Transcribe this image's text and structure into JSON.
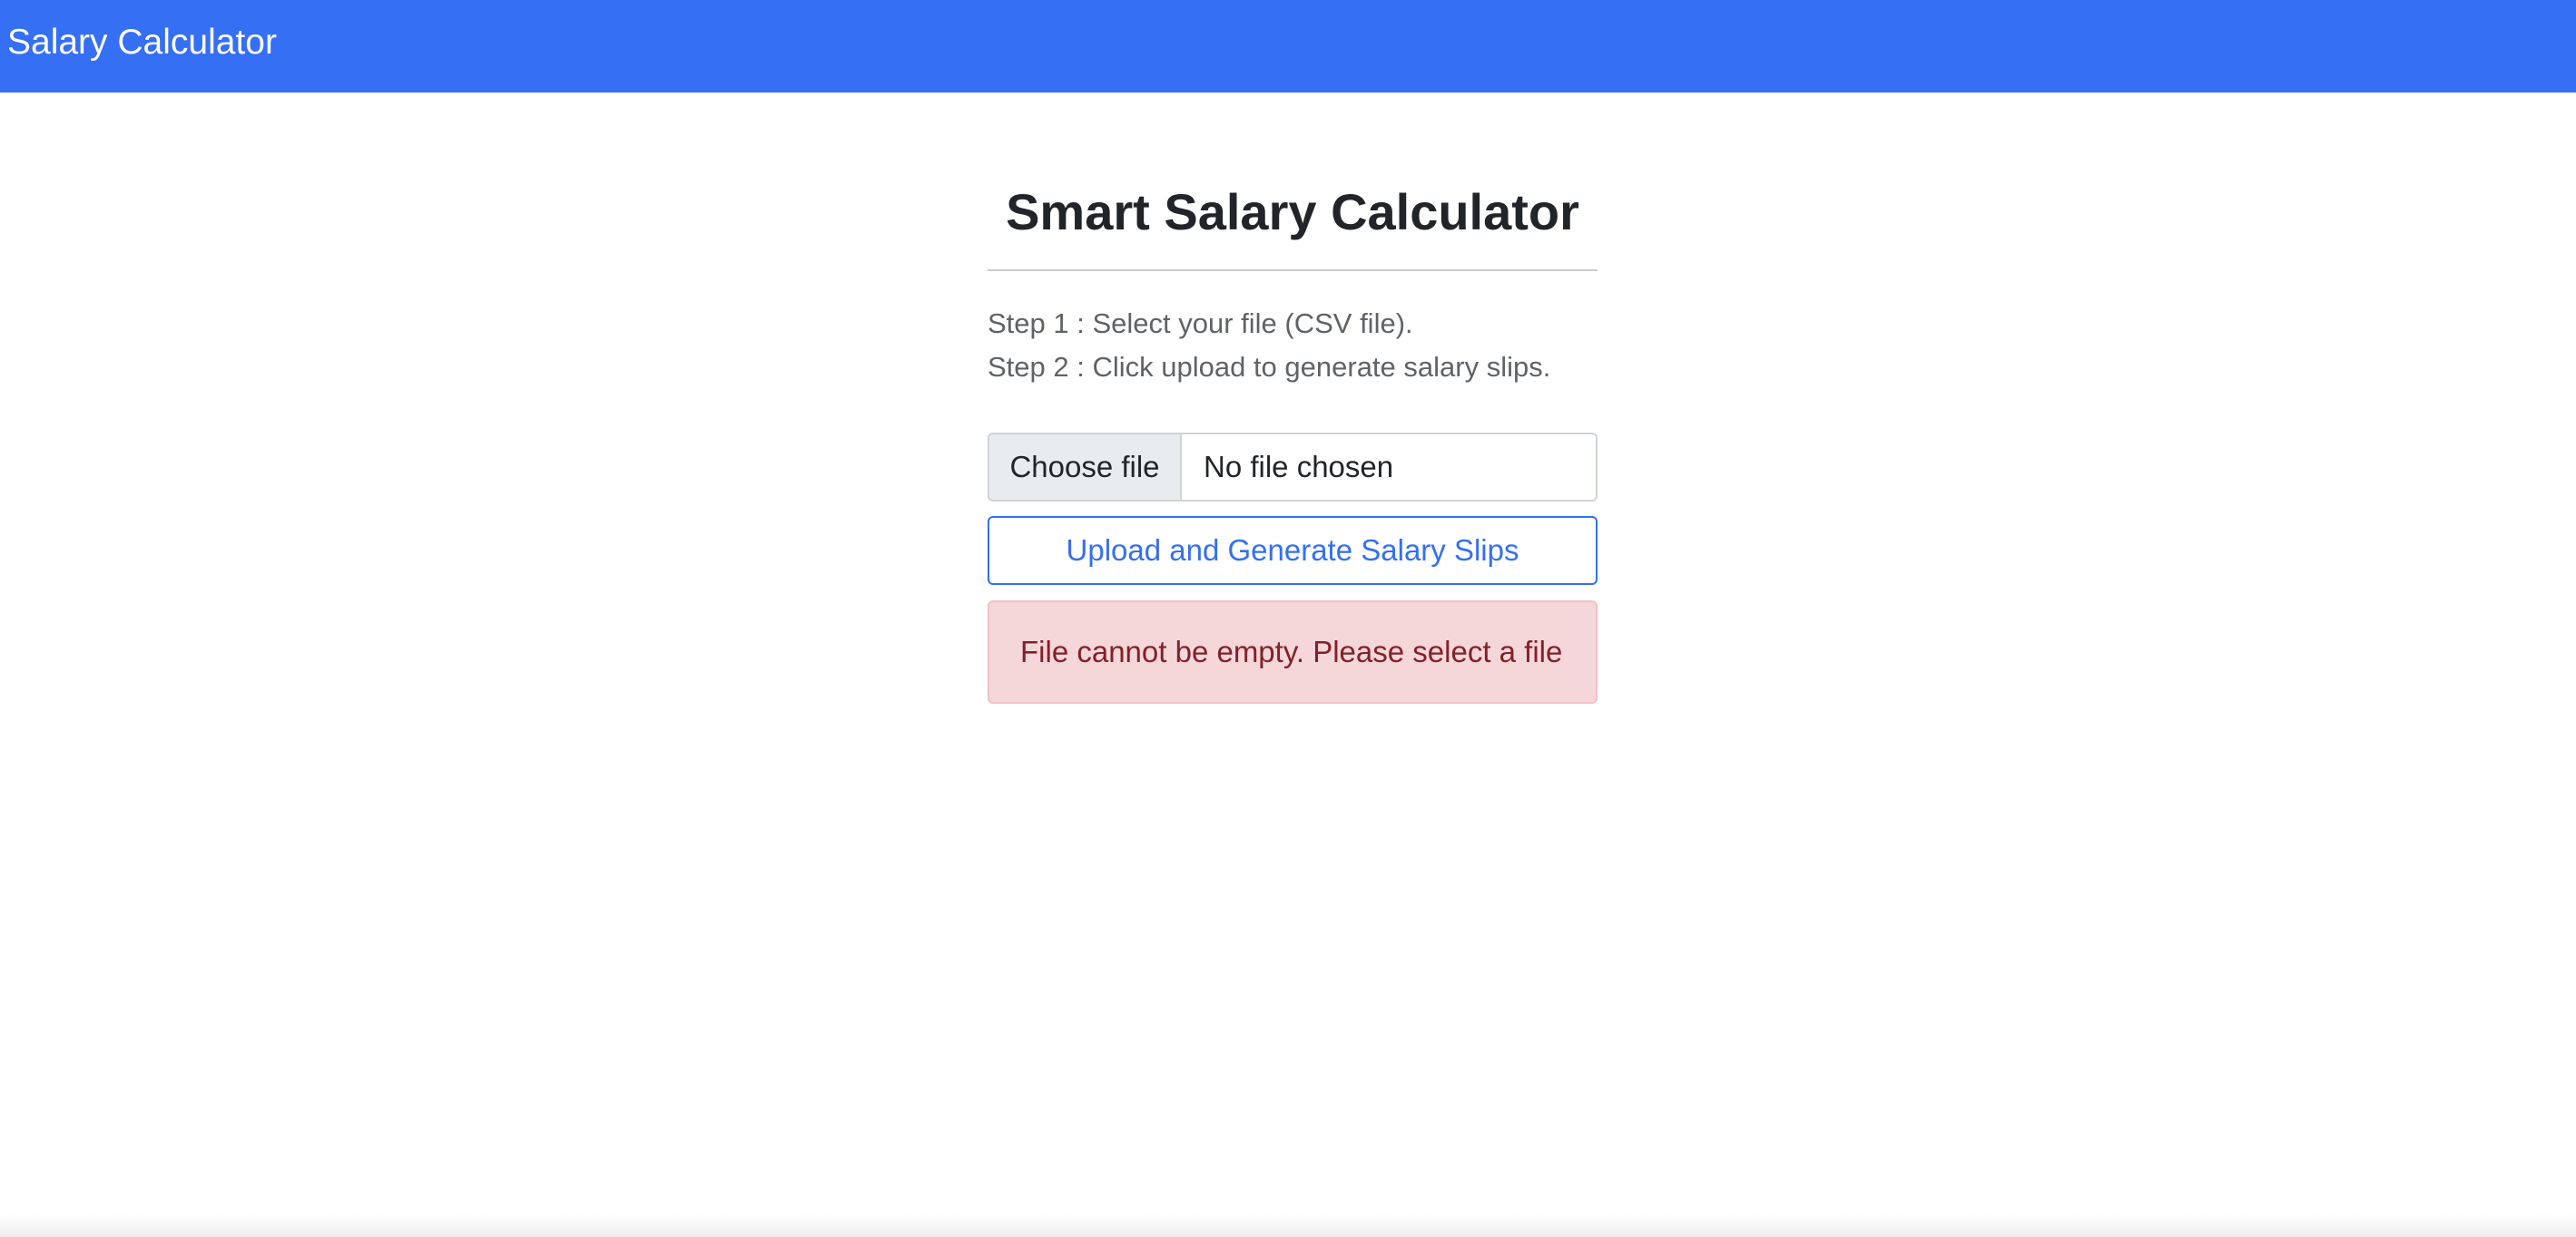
{
  "navbar": {
    "brand": "Salary Calculator",
    "color": "#346ff4"
  },
  "main": {
    "title": "Smart Salary Calculator",
    "steps": [
      "Step 1 : Select your file (CSV file).",
      "Step 2 : Click upload to generate salary slips."
    ],
    "file_input": {
      "button_label": "Choose file",
      "status": "No file chosen"
    },
    "upload_button": {
      "label": "Upload and Generate Salary Slips"
    },
    "alert": {
      "message": "File cannot be empty. Please select a file",
      "type": "danger"
    }
  }
}
